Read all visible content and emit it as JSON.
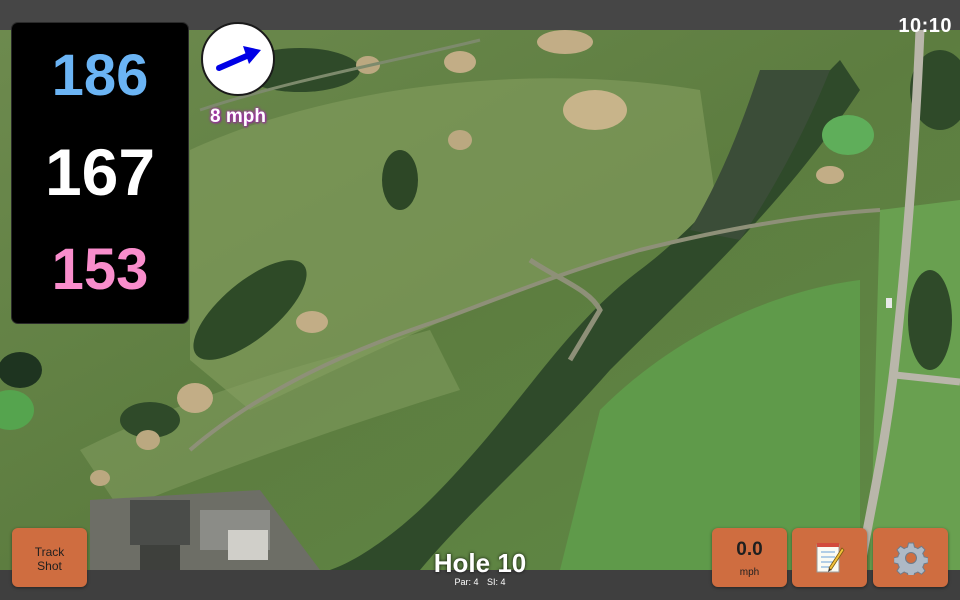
{
  "status_bar": {
    "time": "10:10"
  },
  "yardages": {
    "back": "186",
    "middle": "167",
    "front": "153"
  },
  "wind": {
    "speed_label": "8 mph",
    "arrow_color": "#0000e6",
    "icon": "wind-arrow-icon"
  },
  "hole": {
    "title": "Hole 10",
    "par_label": "Par: 4",
    "si_label": "SI: 4"
  },
  "buttons": {
    "track_shot_line1": "Track",
    "track_shot_line2": "Shot",
    "speed_value": "0.0",
    "speed_unit": "mph",
    "notes_icon": "notepad-icon",
    "settings_icon": "gear-icon"
  },
  "colors": {
    "back_yardage": "#6bb4f4",
    "middle_yardage": "#ffffff",
    "front_yardage": "#f98dcc",
    "button": "#cf6d40"
  }
}
